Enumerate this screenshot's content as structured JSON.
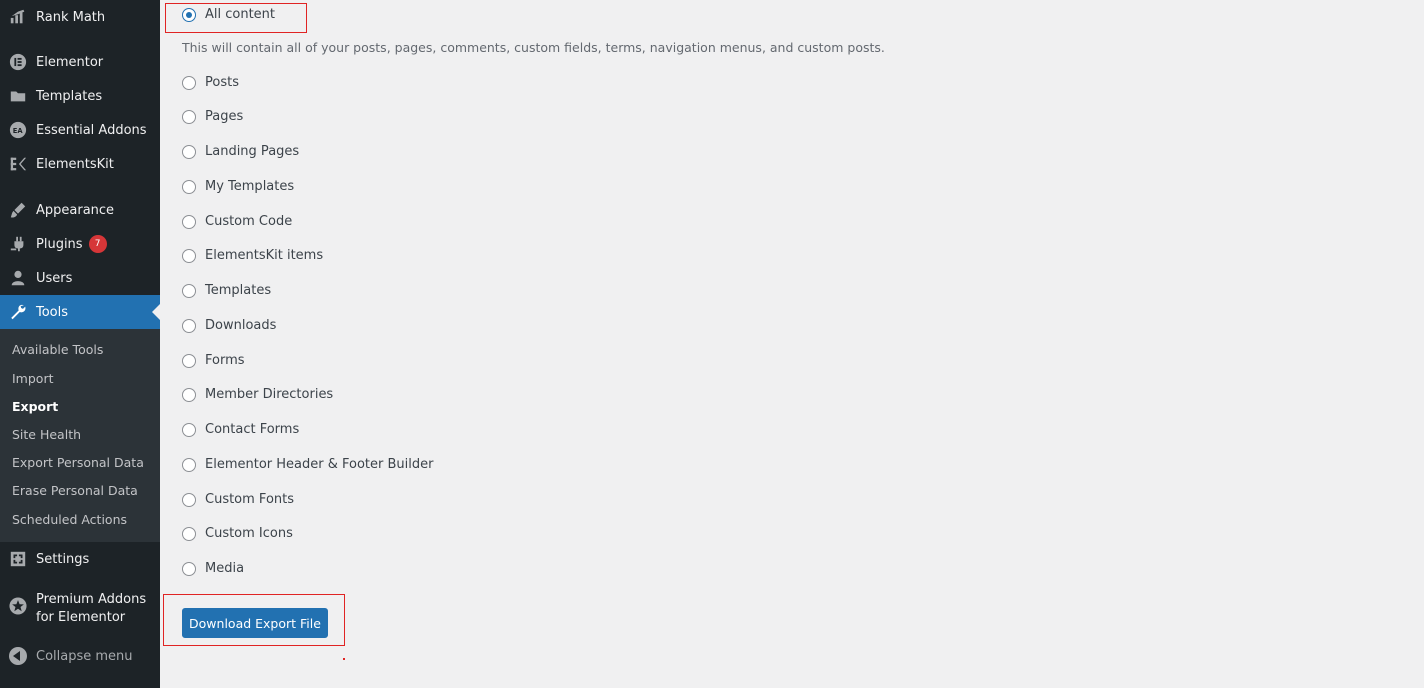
{
  "sidebar": {
    "items": [
      {
        "label": "Rank Math",
        "icon": "rank-math-icon"
      },
      {
        "label": "Elementor",
        "icon": "elementor-icon"
      },
      {
        "label": "Templates",
        "icon": "folder-icon"
      },
      {
        "label": "Essential Addons",
        "icon": "essential-addons-icon"
      },
      {
        "label": "ElementsKit",
        "icon": "elementskit-icon"
      },
      {
        "label": "Appearance",
        "icon": "paintbrush-icon"
      },
      {
        "label": "Plugins",
        "icon": "plugin-icon",
        "badge": "7"
      },
      {
        "label": "Users",
        "icon": "users-icon"
      },
      {
        "label": "Tools",
        "icon": "wrench-icon"
      },
      {
        "label": "Settings",
        "icon": "settings-icon"
      },
      {
        "label": "Premium Addons",
        "label2": "for Elementor",
        "icon": "star-icon"
      },
      {
        "label": "Collapse menu",
        "icon": "collapse-icon"
      }
    ],
    "submenu": [
      {
        "label": "Available Tools"
      },
      {
        "label": "Import"
      },
      {
        "label": "Export"
      },
      {
        "label": "Site Health"
      },
      {
        "label": "Export Personal Data"
      },
      {
        "label": "Erase Personal Data"
      },
      {
        "label": "Scheduled Actions"
      }
    ]
  },
  "export": {
    "options": [
      {
        "label": "All content",
        "checked": true
      },
      {
        "label": "Posts"
      },
      {
        "label": "Pages"
      },
      {
        "label": "Landing Pages"
      },
      {
        "label": "My Templates"
      },
      {
        "label": "Custom Code"
      },
      {
        "label": "ElementsKit items"
      },
      {
        "label": "Templates"
      },
      {
        "label": "Downloads"
      },
      {
        "label": "Forms"
      },
      {
        "label": "Member Directories"
      },
      {
        "label": "Contact Forms"
      },
      {
        "label": "Elementor Header & Footer Builder"
      },
      {
        "label": "Custom Fonts"
      },
      {
        "label": "Custom Icons"
      },
      {
        "label": "Media"
      }
    ],
    "description": "This will contain all of your posts, pages, comments, custom fields, terms, navigation menus, and custom posts.",
    "download_button": "Download Export File"
  },
  "colors": {
    "sidebar_bg": "#1d2327",
    "submenu_bg": "#2c3338",
    "accent": "#2271b1",
    "highlight": "#e02424",
    "badge": "#d63638"
  }
}
